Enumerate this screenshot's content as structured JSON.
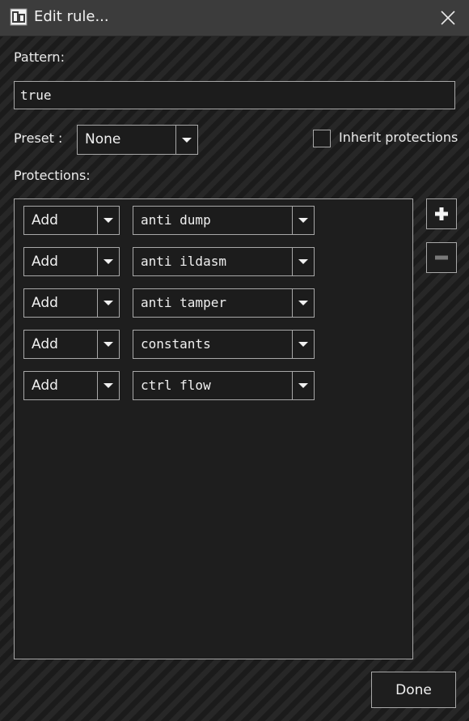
{
  "window": {
    "title": "Edit rule...",
    "app_icon": "confuser-app-icon",
    "close_icon": "close-icon"
  },
  "pattern": {
    "label": "Pattern:",
    "value": "true"
  },
  "preset": {
    "label": "Preset :",
    "value": "None"
  },
  "inherit": {
    "label": "Inherit protections",
    "checked": false
  },
  "protections": {
    "label": "Protections:",
    "rows": [
      {
        "action": "Add",
        "protection": "anti dump"
      },
      {
        "action": "Add",
        "protection": "anti ildasm"
      },
      {
        "action": "Add",
        "protection": "anti tamper"
      },
      {
        "action": "Add",
        "protection": "constants"
      },
      {
        "action": "Add",
        "protection": "ctrl flow"
      }
    ]
  },
  "buttons": {
    "add_icon": "plus-icon",
    "remove_icon": "minus-icon",
    "done": "Done"
  },
  "colors": {
    "titlebar": "#3c3c3c",
    "background": "#1b1b1b",
    "border": "#a8a8a8",
    "text": "#f0f0f0"
  }
}
